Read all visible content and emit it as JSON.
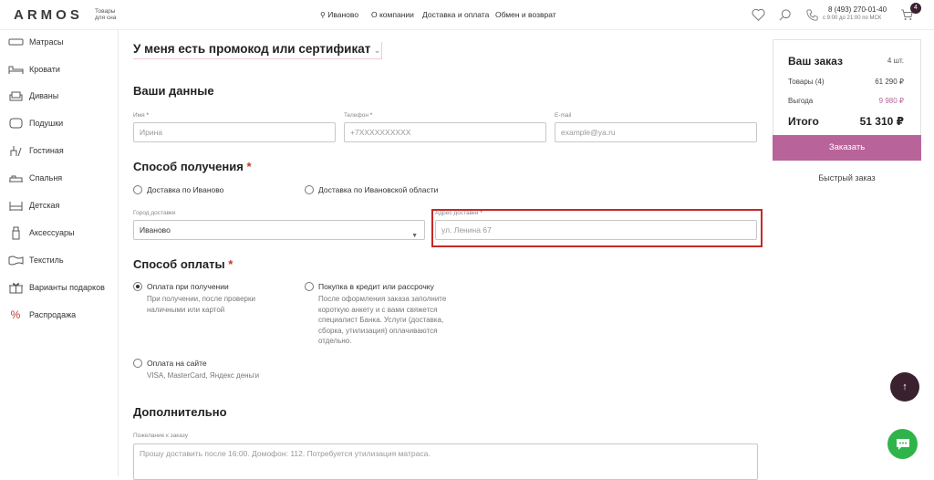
{
  "header": {
    "logo": "ARMOS",
    "logo_sub": "Товары для сна",
    "city": "Иваново",
    "nav": [
      "О компании",
      "Доставка и оплата",
      "Обмен и возврат"
    ],
    "phone": "8 (493) 270-01-40",
    "phone_hours": "с 9:00 до 21:00 по МСК",
    "cart_count": "4"
  },
  "sidebar": {
    "items": [
      {
        "label": "Матрасы",
        "icon": "mattress-icon"
      },
      {
        "label": "Кровати",
        "icon": "bed-icon"
      },
      {
        "label": "Диваны",
        "icon": "sofa-icon"
      },
      {
        "label": "Подушки",
        "icon": "pillow-icon"
      },
      {
        "label": "Гостиная",
        "icon": "living-room-icon"
      },
      {
        "label": "Спальня",
        "icon": "bedroom-icon"
      },
      {
        "label": "Детская",
        "icon": "kids-room-icon"
      },
      {
        "label": "Аксессуары",
        "icon": "accessories-icon"
      },
      {
        "label": "Текстиль",
        "icon": "textile-icon"
      },
      {
        "label": "Варианты подарков",
        "icon": "gift-icon"
      },
      {
        "label": "Распродажа",
        "icon": "percent-icon"
      }
    ]
  },
  "main": {
    "promo_toggle": "У меня есть промокод или сертификат",
    "your_data_title": "Ваши данные",
    "name_label": "Имя",
    "name_value": "Ирина",
    "phone_label": "Телефон",
    "phone_placeholder": "+7XXXXXXXXXX",
    "email_label": "E-mail",
    "email_placeholder": "example@ya.ru",
    "delivery_title": "Способ получения",
    "delivery_options": [
      "Доставка по Иваново",
      "Доставка по Ивановской области"
    ],
    "city_label": "Город доставки",
    "city_value": "Иваново",
    "address_label": "Адрес доставки",
    "address_value": "ул. Ленина 67",
    "payment_title": "Способ оплаты",
    "payment_options": [
      {
        "label": "Оплата при получении",
        "desc": "При получении, после проверки наличными или картой"
      },
      {
        "label": "Покупка в кредит или рассрочку",
        "desc": "После оформления заказа заполните короткую анкету и с вами свяжется специалист Банка. Услуги (доставка, сборка, утилизация) оплачиваются отдельно."
      },
      {
        "label": "Оплата на сайте",
        "desc": "VISA, MasterCard, Яндекс деньги"
      }
    ],
    "extra_title": "Дополнительно",
    "comment_label": "Пожелание к заказу",
    "comment_value": "Прошу доставить после 16:00. Домофон: 112. Потребуется утилизация матраса.",
    "required_mark": "*"
  },
  "order": {
    "title": "Ваш заказ",
    "count": "4 шт.",
    "goods_label": "Товары (4)",
    "goods_value": "61 290 ₽",
    "benefit_label": "Выгода",
    "benefit_value": "9 980 ₽",
    "total_label": "Итого",
    "total_value": "51 310 ₽",
    "order_button": "Заказать",
    "quick_order": "Быстрый заказ"
  },
  "colors": {
    "accent": "#b8649a",
    "dark": "#3b2030",
    "chat": "#2fb44a",
    "highlight": "#c62828"
  }
}
